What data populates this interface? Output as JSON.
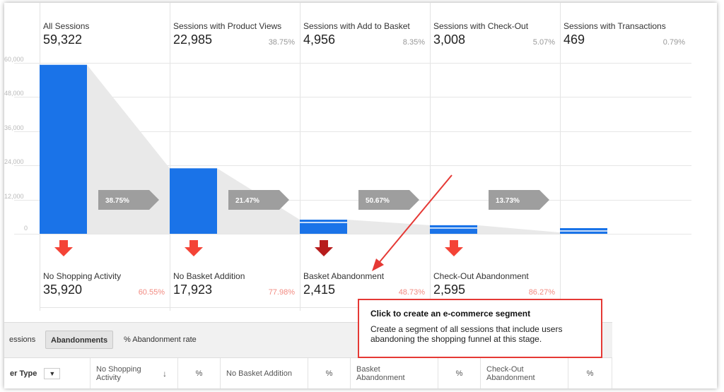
{
  "stages": [
    {
      "label": "All Sessions",
      "value": "59,322",
      "pct": ""
    },
    {
      "label": "Sessions with Product Views",
      "value": "22,985",
      "pct": "38.75%"
    },
    {
      "label": "Sessions with Add to Basket",
      "value": "4,956",
      "pct": "8.35%"
    },
    {
      "label": "Sessions with Check-Out",
      "value": "3,008",
      "pct": "5.07%"
    },
    {
      "label": "Sessions with Transactions",
      "value": "469",
      "pct": "0.79%"
    }
  ],
  "conversion_arrows": [
    "38.75%",
    "21.47%",
    "50.67%",
    "13.73%"
  ],
  "abandonments": [
    {
      "label": "No Shopping Activity",
      "value": "35,920",
      "pct": "60.55%"
    },
    {
      "label": "No Basket Addition",
      "value": "17,923",
      "pct": "77.98%"
    },
    {
      "label": "Basket Abandonment",
      "value": "2,415",
      "pct": "48.73%"
    },
    {
      "label": "Check-Out Abandonment",
      "value": "2,595",
      "pct": "86.27%"
    }
  ],
  "yaxis_ticks": [
    "60,000",
    "48,000",
    "36,000",
    "24,000",
    "12,000",
    "0"
  ],
  "tabs": {
    "sessions": "essions",
    "abandonments": "Abandonments",
    "rate": "% Abandonment rate"
  },
  "table_headers": {
    "type": "er Type",
    "no_shopping": "No Shopping Activity",
    "pct1": "%",
    "no_basket": "No Basket Addition",
    "pct2": "%",
    "basket": "Basket Abandonment",
    "pct3": "%",
    "checkout": "Check-Out Abandonment",
    "pct4": "%"
  },
  "tooltip": {
    "title": "Click to create an e-commerce segment",
    "body": "Create a segment of all sessions that include users abandoning the shopping funnel at this stage."
  },
  "colors": {
    "bar": "#1a73e8",
    "arrow_red": "#f44336",
    "arrow_dark_red": "#b71c1c",
    "chevron": "#9e9e9e",
    "funnel_fill": "#e9e9e9",
    "annotation_red": "#e53935"
  },
  "chart_data": {
    "type": "bar",
    "categories": [
      "All Sessions",
      "Sessions with Product Views",
      "Sessions with Add to Basket",
      "Sessions with Check-Out",
      "Sessions with Transactions"
    ],
    "values": [
      59322,
      22985,
      4956,
      3008,
      469
    ],
    "ylim": [
      0,
      60000
    ],
    "yticks": [
      0,
      12000,
      24000,
      36000,
      48000,
      60000
    ],
    "grid": true
  }
}
